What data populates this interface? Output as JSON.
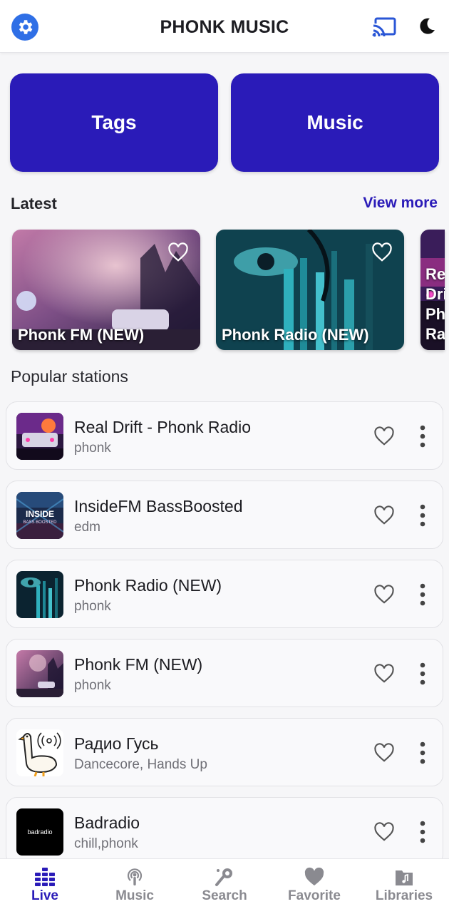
{
  "header": {
    "title": "PHONK MUSIC",
    "settings_icon": "gear-icon",
    "cast_icon": "cast-icon",
    "theme_icon": "moon-icon"
  },
  "quick_buttons": {
    "tags_label": "Tags",
    "music_label": "Music"
  },
  "latest": {
    "title": "Latest",
    "view_more": "View more",
    "cards": [
      {
        "label": "Phonk FM (NEW)"
      },
      {
        "label": "Phonk Radio (NEW)"
      },
      {
        "label": "Real Drift - Phonk Radio"
      }
    ]
  },
  "popular": {
    "title": "Popular stations",
    "stations": [
      {
        "name": "Real Drift - Phonk Radio",
        "tags": "phonk"
      },
      {
        "name": "InsideFM BassBoosted",
        "tags": "edm",
        "thumb_text": "INSIDE",
        "thumb_subtext": "BASS BOOSTED"
      },
      {
        "name": "Phonk Radio (NEW)",
        "tags": "phonk"
      },
      {
        "name": "Phonk FM (NEW)",
        "tags": "phonk"
      },
      {
        "name": "Радио Гусь",
        "tags": "Dancecore, Hands Up"
      },
      {
        "name": "Badradio",
        "tags": "chill,phonk",
        "thumb_text": "badradio"
      }
    ]
  },
  "bottom_nav": {
    "items": [
      {
        "label": "Live",
        "icon": "equalizer-icon",
        "active": true
      },
      {
        "label": "Music",
        "icon": "podcast-icon",
        "active": false
      },
      {
        "label": "Search",
        "icon": "microphone-search-icon",
        "active": false
      },
      {
        "label": "Favorite",
        "icon": "heart-icon",
        "active": false
      },
      {
        "label": "Libraries",
        "icon": "music-folder-icon",
        "active": false
      }
    ]
  },
  "colors": {
    "accent": "#2a1bb8",
    "settings_blue": "#2f6fe6",
    "inactive_nav": "#8a8a90"
  }
}
